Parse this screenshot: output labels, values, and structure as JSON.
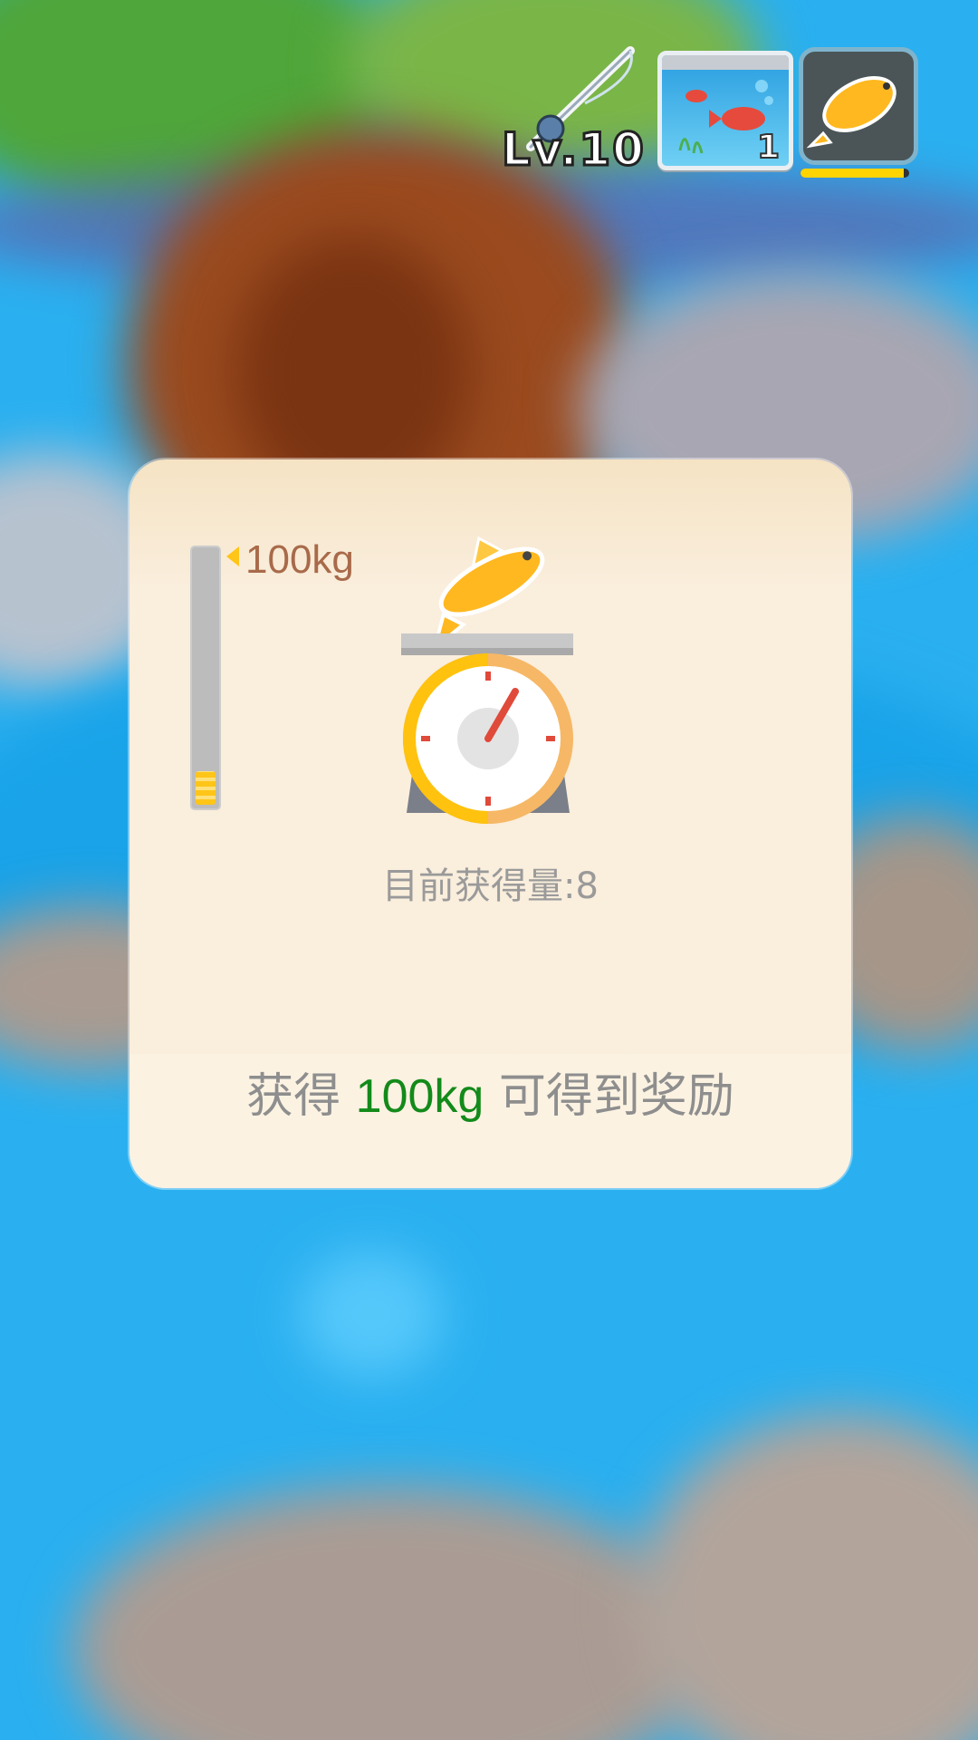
{
  "hud": {
    "level_text": "Lv.10",
    "aquarium_count": "1",
    "progress_fraction": 0.95,
    "icons": [
      "fishing-rod-icon",
      "aquarium-icon",
      "golden-fish-icon"
    ]
  },
  "panel": {
    "goal_label": "100kg",
    "gauge_fraction": 0.08,
    "current_text": "目前获得量:8",
    "reward_prefix": "获得 ",
    "reward_amount": "100kg",
    "reward_suffix": " 可得到奖励",
    "colors": {
      "highlight": "#138a1a",
      "gauge_fill": "#ffc518",
      "panel_bg": "#faeedb",
      "water": "#2ab0f0"
    }
  }
}
